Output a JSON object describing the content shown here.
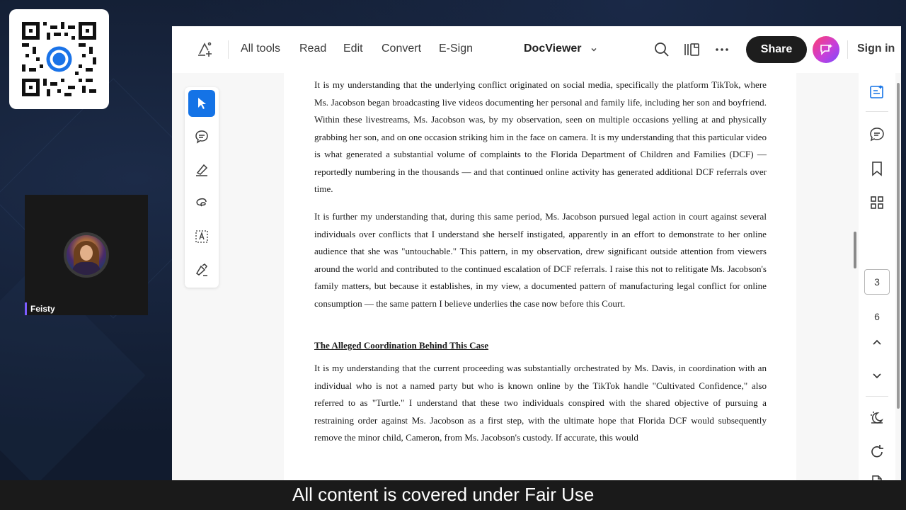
{
  "participant": {
    "name": "Feisty"
  },
  "toolbar": {
    "nav": [
      "All tools",
      "Read",
      "Edit",
      "Convert",
      "E-Sign"
    ],
    "doc_title": "DocViewer",
    "share_label": "Share",
    "signin_label": "Sign in"
  },
  "document": {
    "paragraph1": "It is my understanding that the underlying conflict originated on social media, specifically the platform TikTok, where Ms. Jacobson began broadcasting live videos documenting her personal and family life, including her son and boyfriend. Within these livestreams, Ms. Jacobson was, by my observation, seen on multiple occasions yelling at and physically grabbing her son, and on one occasion striking him in the face on camera. It is my understanding that this particular video is what generated a substantial volume of complaints to the Florida Department of Children and Families (DCF) — reportedly numbering in the thousands — and that continued online activity has generated additional DCF referrals over time.",
    "paragraph2": "It is further my understanding that, during this same period, Ms. Jacobson pursued legal action in court against several individuals over conflicts that I understand she herself instigated, apparently in an effort to demonstrate to her online audience that she was \"untouchable.\" This pattern, in my observation, drew significant outside attention from viewers around the world and contributed to the continued escalation of DCF referrals. I raise this not to relitigate Ms. Jacobson's family matters, but because it establishes, in my view, a documented pattern of manufacturing legal conflict for online consumption — the same pattern I believe underlies the case now before this Court.",
    "heading": "The Alleged Coordination Behind This Case",
    "paragraph3": "It is my understanding that the current proceeding was substantially orchestrated by Ms. Davis, in coordination with an individual who is not a named party but who is known online by the TikTok handle \"Cultivated Confidence,\" also referred to as \"Turtle.\" I understand that these two individuals conspired with the shared objective of pursuing a restraining order against Ms. Jacobson as a first step, with the ultimate hope that Florida DCF would subsequently remove the minor child, Cameron, from Ms. Jacobson's custody. If accurate, this would"
  },
  "pager": {
    "current": "3",
    "total": "6"
  },
  "caption": "All content is covered under Fair Use",
  "colors": {
    "accent": "#1473e6",
    "share_bg": "#1d1d1d",
    "name_bar": "#7b5cff"
  },
  "icons": [
    "qr-code-icon",
    "tools-icon",
    "chevron-down-icon",
    "search-icon",
    "panels-icon",
    "more-icon",
    "ai-assistant-icon",
    "select-arrow-icon",
    "comment-icon",
    "highlight-pen-icon",
    "lasso-icon",
    "text-select-icon",
    "sign-pen-icon",
    "summary-icon",
    "comments-panel-icon",
    "bookmark-icon",
    "thumbnails-icon",
    "chevron-up-icon",
    "night-mode-icon",
    "rotate-icon",
    "export-icon"
  ]
}
